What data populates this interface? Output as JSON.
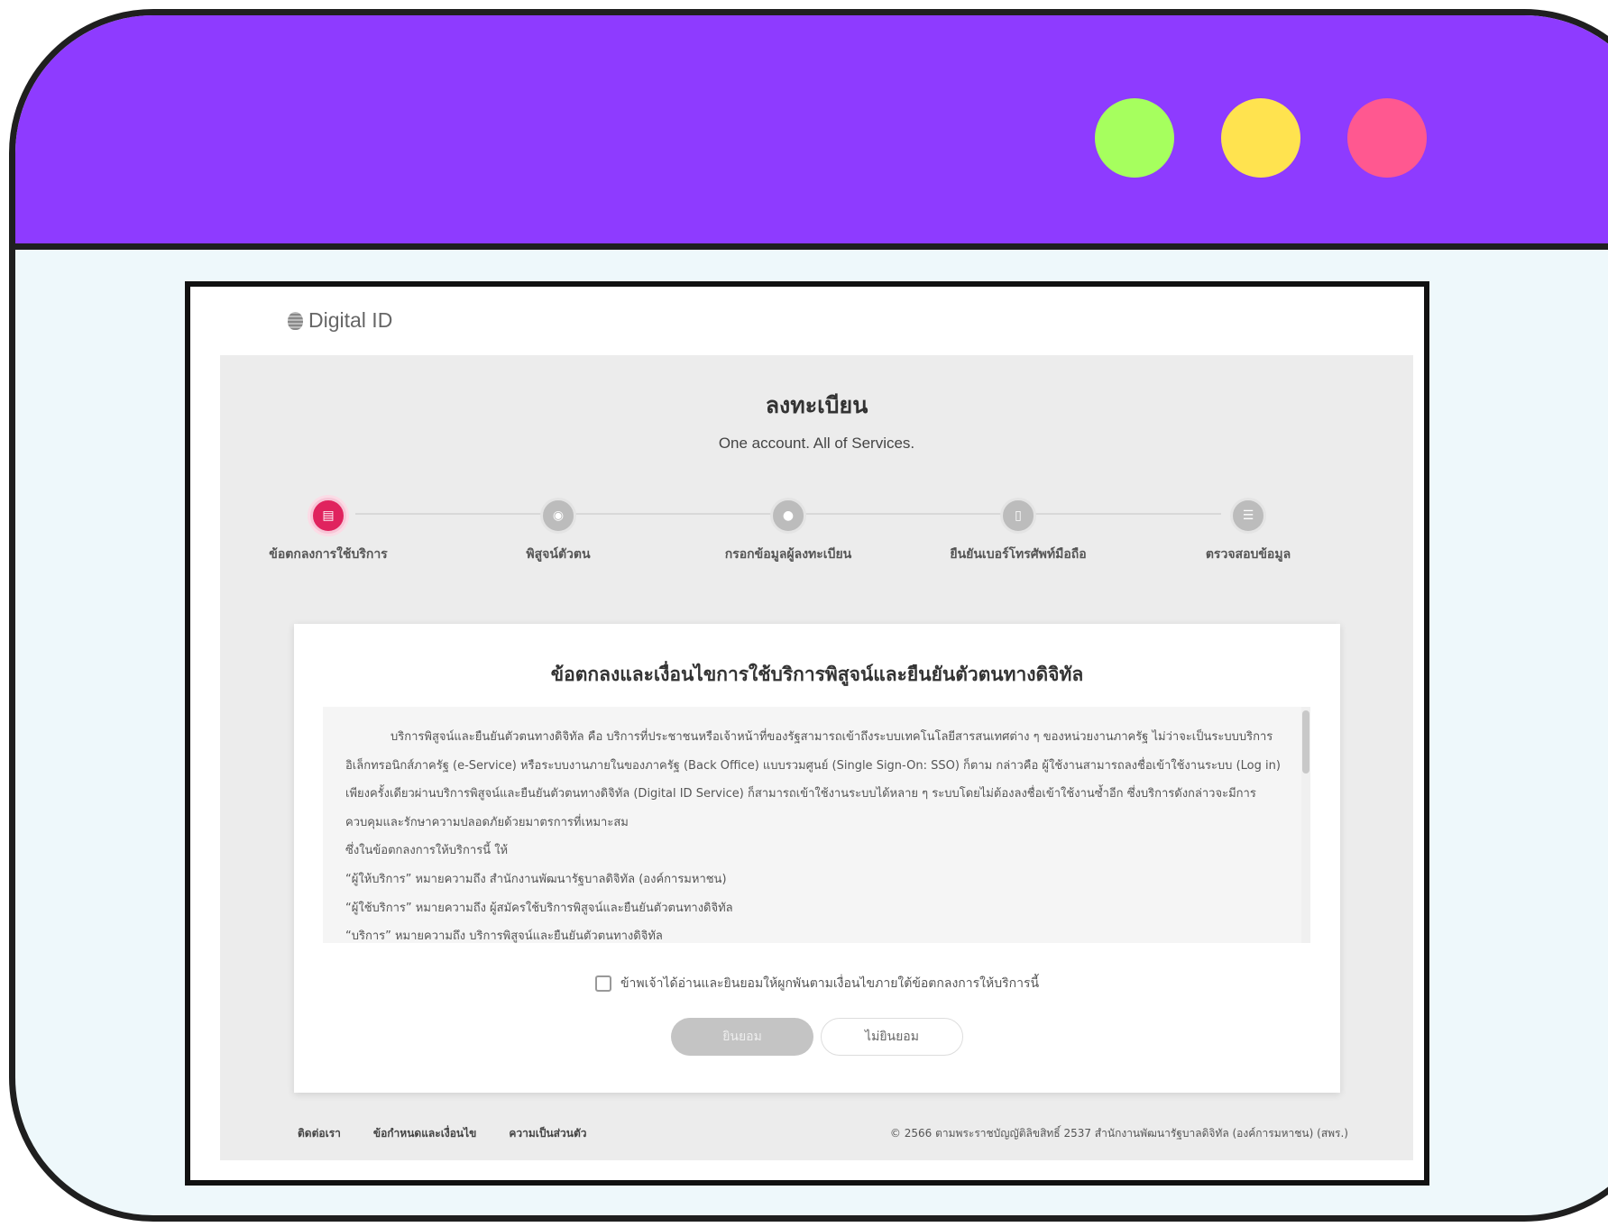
{
  "window": {
    "dots": [
      {
        "name": "green",
        "color": "#a6ff5e"
      },
      {
        "name": "yellow",
        "color": "#ffe34f"
      },
      {
        "name": "red",
        "color": "#ff5890"
      }
    ],
    "frame_color": "#8e3bff"
  },
  "header": {
    "logo_text": "Digital ID",
    "logo_icon": "fingerprint-icon"
  },
  "page": {
    "title": "ลงทะเบียน",
    "subtitle": "One account. All of Services."
  },
  "steps": [
    {
      "label": "ข้อตกลงการใช้บริการ",
      "icon": "document-icon",
      "active": true
    },
    {
      "label": "พิสูจน์ตัวตน",
      "icon": "fingerprint-icon",
      "active": false
    },
    {
      "label": "กรอกข้อมูลผู้ลงทะเบียน",
      "icon": "user-icon",
      "active": false
    },
    {
      "label": "ยืนยันเบอร์โทรศัพท์มือถือ",
      "icon": "mobile-icon",
      "active": false
    },
    {
      "label": "ตรวจสอบข้อมูล",
      "icon": "checklist-icon",
      "active": false
    }
  ],
  "terms": {
    "title": "ข้อตกลงและเงื่อนไขการใช้บริการพิสูจน์และยืนยันตัวตนทางดิจิทัล",
    "paragraph": "บริการพิสูจน์และยืนยันตัวตนทางดิจิทัล คือ บริการที่ประชาชนหรือเจ้าหน้าที่ของรัฐสามารถเข้าถึงระบบเทคโนโลยีสารสนเทศต่าง ๆ ของหน่วยงานภาครัฐ ไม่ว่าจะเป็นระบบบริการอิเล็กทรอนิกส์ภาครัฐ (e-Service) หรือระบบงานภายในของภาครัฐ (Back Office) แบบรวมศูนย์ (Single Sign-On: SSO) ก็ตาม กล่าวคือ ผู้ใช้งานสามารถลงชื่อเข้าใช้งานระบบ (Log in) เพียงครั้งเดียวผ่านบริการพิสูจน์และยืนยันตัวตนทางดิจิทัล (Digital ID Service) ก็สามารถเข้าใช้งานระบบได้หลาย ๆ ระบบโดยไม่ต้องลงชื่อเข้าใช้งานซ้ำอีก ซึ่งบริการดังกล่าวจะมีการควบคุมและรักษาความปลอดภัยด้วยมาตรการที่เหมาะสม",
    "lines": [
      "ซึ่งในข้อตกลงการให้บริการนี้ ให้",
      "“ผู้ให้บริการ” หมายความถึง สำนักงานพัฒนารัฐบาลดิจิทัล (องค์การมหาชน)",
      "“ผู้ใช้บริการ” หมายความถึง ผู้สมัครใช้บริการพิสูจน์และยืนยันตัวตนทางดิจิทัล",
      "“บริการ” หมายความถึง บริการพิสูจน์และยืนยันตัวตนทางดิจิทัล"
    ],
    "agree_label": "ข้าพเจ้าได้อ่านและยินยอมให้ผูกพันตามเงื่อนไขภายใต้ข้อตกลงการให้บริการนี้",
    "accept_label": "ยินยอม",
    "decline_label": "ไม่ยินยอม"
  },
  "footer": {
    "links": [
      "ติดต่อเรา",
      "ข้อกำหนดและเงื่อนไข",
      "ความเป็นส่วนตัว"
    ],
    "copyright": "© 2566 ตามพระราชบัญญัติลิขสิทธิ์ 2537 สำนักงานพัฒนารัฐบาลดิจิทัล (องค์การมหาชน) (สพร.)"
  }
}
